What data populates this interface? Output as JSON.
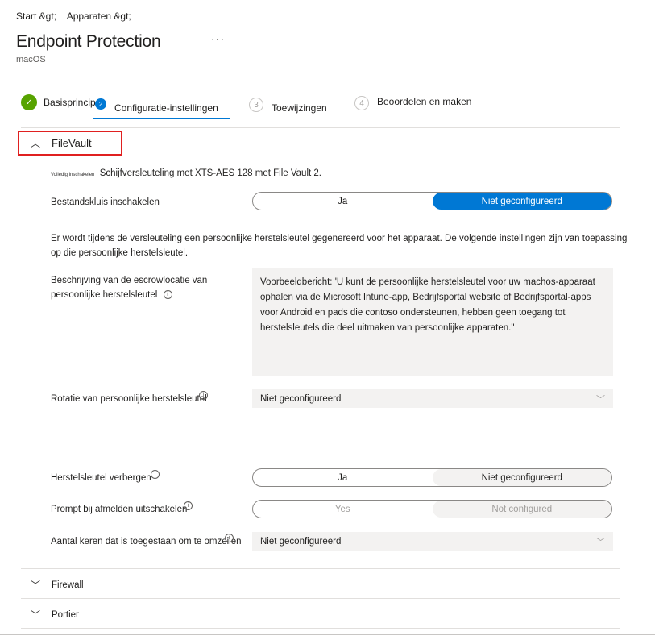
{
  "breadcrumb": [
    "Start &gt;",
    "Apparaten &gt;"
  ],
  "header": {
    "title": "Endpoint Protection",
    "more_label": "···",
    "subtitle": "macOS"
  },
  "wizard": {
    "steps": [
      {
        "number": "",
        "label": "Basisprincipes",
        "state": "complete"
      },
      {
        "number": "2",
        "label": "Configuratie-instellingen",
        "state": "active"
      },
      {
        "number": "3",
        "label": "Toewijzingen",
        "state": "inactive"
      },
      {
        "number": "4",
        "label": "Beoordelen en maken",
        "state": "inactive"
      }
    ],
    "check_glyph": "✓"
  },
  "filevault": {
    "label": "FileVault",
    "expanded": true,
    "enable_small_label": "Volledig inschakelen",
    "enable_description": "Schijfversleuteling met XTS-AES 128 met File Vault 2.",
    "enable_setting": {
      "label": "Bestandskluis inschakelen",
      "options": [
        "Ja",
        "Niet geconfigureerd"
      ],
      "selected": "Niet geconfigureerd"
    },
    "info_text": "Er wordt tijdens de versleuteling een persoonlijke herstelsleutel gegenereerd voor het apparaat. De volgende instellingen zijn van toepassing op die persoonlijke herstelsleutel.",
    "escrow": {
      "label": "Beschrijving van de escrowlocatie van persoonlijke herstelsleutel",
      "placeholder": "Voorbeeldbericht: 'U kunt de persoonlijke herstelsleutel voor uw machos-apparaat ophalen via de Microsoft Intune-app, Bedrijfsportal website of Bedrijfsportal-apps voor Android en pads die contoso ondersteunen, hebben geen toegang tot herstelsleutels die deel uitmaken van persoonlijke apparaten.\""
    },
    "rotation": {
      "label": "Rotatie van persoonlijke herstelsleutel",
      "value": "Niet geconfigureerd"
    },
    "hide_key": {
      "label": "Herstelsleutel verbergen",
      "options": [
        "Ja",
        "Niet geconfigureerd"
      ],
      "selected": "Niet geconfigureerd"
    },
    "disable_prompt": {
      "label": "Prompt bij afmelden uitschakelen",
      "options": [
        "Yes",
        "Not configured"
      ],
      "selected": "Not configured",
      "disabled": true
    },
    "bypass_count": {
      "label": "Aantal keren dat is toegestaan om te omzeilen",
      "value": "Niet geconfigureerd"
    }
  },
  "sections": [
    {
      "label": "Firewall",
      "expanded": false
    },
    {
      "label": "Portier",
      "expanded": false
    }
  ],
  "icons": {
    "chevron_up": "︿",
    "chevron_down": "﹀",
    "info": "i",
    "dropdown_chevron": "﹀"
  },
  "colors": {
    "accent": "#0078d4",
    "success": "#57a300",
    "highlight_border": "#e02020"
  }
}
